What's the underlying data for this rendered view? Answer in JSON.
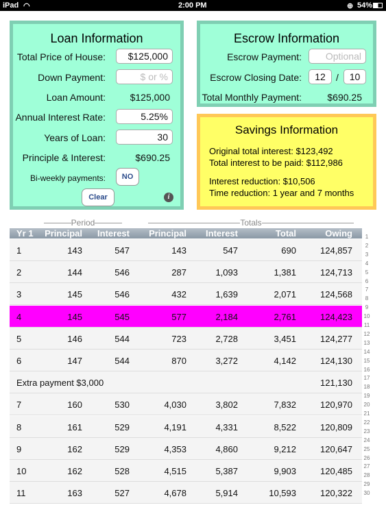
{
  "status_bar": {
    "device": "iPad",
    "time": "2:00 PM",
    "battery": "54%"
  },
  "loan": {
    "title": "Loan Information",
    "price_label": "Total Price of House:",
    "price_value": "$125,000",
    "down_label": "Down Payment:",
    "down_placeholder": "$ or %",
    "amount_label": "Loan Amount:",
    "amount_value": "$125,000",
    "rate_label": "Annual Interest Rate:",
    "rate_value": "5.25%",
    "years_label": "Years of Loan:",
    "years_value": "30",
    "pi_label": "Principle & Interest:",
    "pi_value": "$690.25",
    "biweekly_label": "Bi-weekly payments:",
    "biweekly_value": "NO",
    "clear_label": "Clear",
    "info_icon": "i"
  },
  "escrow": {
    "title": "Escrow Information",
    "payment_label": "Escrow Payment:",
    "payment_placeholder": "Optional",
    "closing_label": "Escrow Closing Date:",
    "month": "12",
    "sep": "/",
    "year": "10",
    "total_label": "Total Monthly Payment:",
    "total_value": "$690.25"
  },
  "savings": {
    "title": "Savings Information",
    "original": "Original total interest: $123,492",
    "to_pay": "Total interest to be paid: $112,986",
    "reduction": "Interest reduction: $10,506",
    "time": "Time reduction: 1 year and 7 months"
  },
  "table": {
    "group_period": "Period",
    "group_totals": "Totals",
    "headers": [
      "Yr 1",
      "Principal",
      "Interest",
      "Principal",
      "Interest",
      "Total",
      "Owing"
    ],
    "highlight_color": "#ff00ff",
    "rows": [
      [
        "1",
        "143",
        "547",
        "143",
        "547",
        "690",
        "124,857"
      ],
      [
        "2",
        "144",
        "546",
        "287",
        "1,093",
        "1,381",
        "124,713"
      ],
      [
        "3",
        "145",
        "546",
        "432",
        "1,639",
        "2,071",
        "124,568"
      ],
      [
        "4",
        "145",
        "545",
        "577",
        "2,184",
        "2,761",
        "124,423"
      ],
      [
        "5",
        "146",
        "544",
        "723",
        "2,728",
        "3,451",
        "124,277"
      ],
      [
        "6",
        "147",
        "544",
        "870",
        "3,272",
        "4,142",
        "124,130"
      ],
      [
        "Extra payment $3,000",
        "",
        "",
        "",
        "",
        "",
        "121,130"
      ],
      [
        "7",
        "160",
        "530",
        "4,030",
        "3,802",
        "7,832",
        "120,970"
      ],
      [
        "8",
        "161",
        "529",
        "4,191",
        "4,331",
        "8,522",
        "120,809"
      ],
      [
        "9",
        "162",
        "529",
        "4,353",
        "4,860",
        "9,212",
        "120,647"
      ],
      [
        "10",
        "162",
        "528",
        "4,515",
        "5,387",
        "9,903",
        "120,485"
      ],
      [
        "11",
        "163",
        "527",
        "4,678",
        "5,914",
        "10,593",
        "120,322"
      ]
    ],
    "highlighted_row": 3,
    "index": [
      "1",
      "2",
      "3",
      "4",
      "5",
      "6",
      "7",
      "8",
      "9",
      "10",
      "11",
      "12",
      "13",
      "14",
      "15",
      "16",
      "17",
      "18",
      "19",
      "20",
      "21",
      "22",
      "23",
      "24",
      "25",
      "26",
      "27",
      "28",
      "29",
      "30"
    ]
  }
}
